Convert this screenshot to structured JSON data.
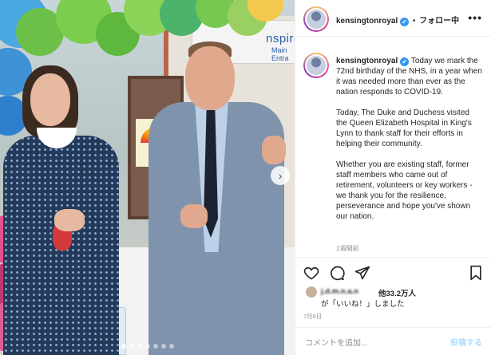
{
  "post": {
    "username": "kensingtonroyal",
    "verified_mark": "✔",
    "separator": "•",
    "follow_status": "フォロー中",
    "more_glyph": "•••",
    "caption": {
      "p1": "Today we mark the 72nd birthday of the NHS, in a year when it was needed more than ever as the nation responds to COVID-19.",
      "p2": "Today, The Duke and Duchess visited the Queen Elizabeth Hospital in King's Lynn to thank staff for their efforts in helping their community.",
      "p3": "Whether you are existing staff, former staff members who came out of retirement, volunteers or key workers - we thank you for the resilience, perseverance and hope you've shown our nation."
    },
    "time_ago": "1週間前",
    "likes": {
      "liker": "j.d.m.n.a.n",
      "others": "他33.2万人",
      "liked_text": "が「いいね！」しました"
    },
    "date": "7月6日",
    "comment_placeholder": "コメントを追加...",
    "post_button": "投稿する"
  },
  "photo": {
    "sign_text": "nspire",
    "sign_sub": "Main Entra",
    "carousel_count": 7,
    "carousel_active": 0,
    "next_glyph": "›"
  },
  "icons": {
    "header_avatar": "kensington-avatar-icon",
    "like": "heart-icon",
    "comment": "comment-icon",
    "share": "paper-plane-icon",
    "save": "bookmark-icon",
    "more": "more-options-icon"
  },
  "colors": {
    "verified": "#3897f0",
    "post_button": "#b2dffc",
    "muted_text": "#8e8e8e"
  }
}
